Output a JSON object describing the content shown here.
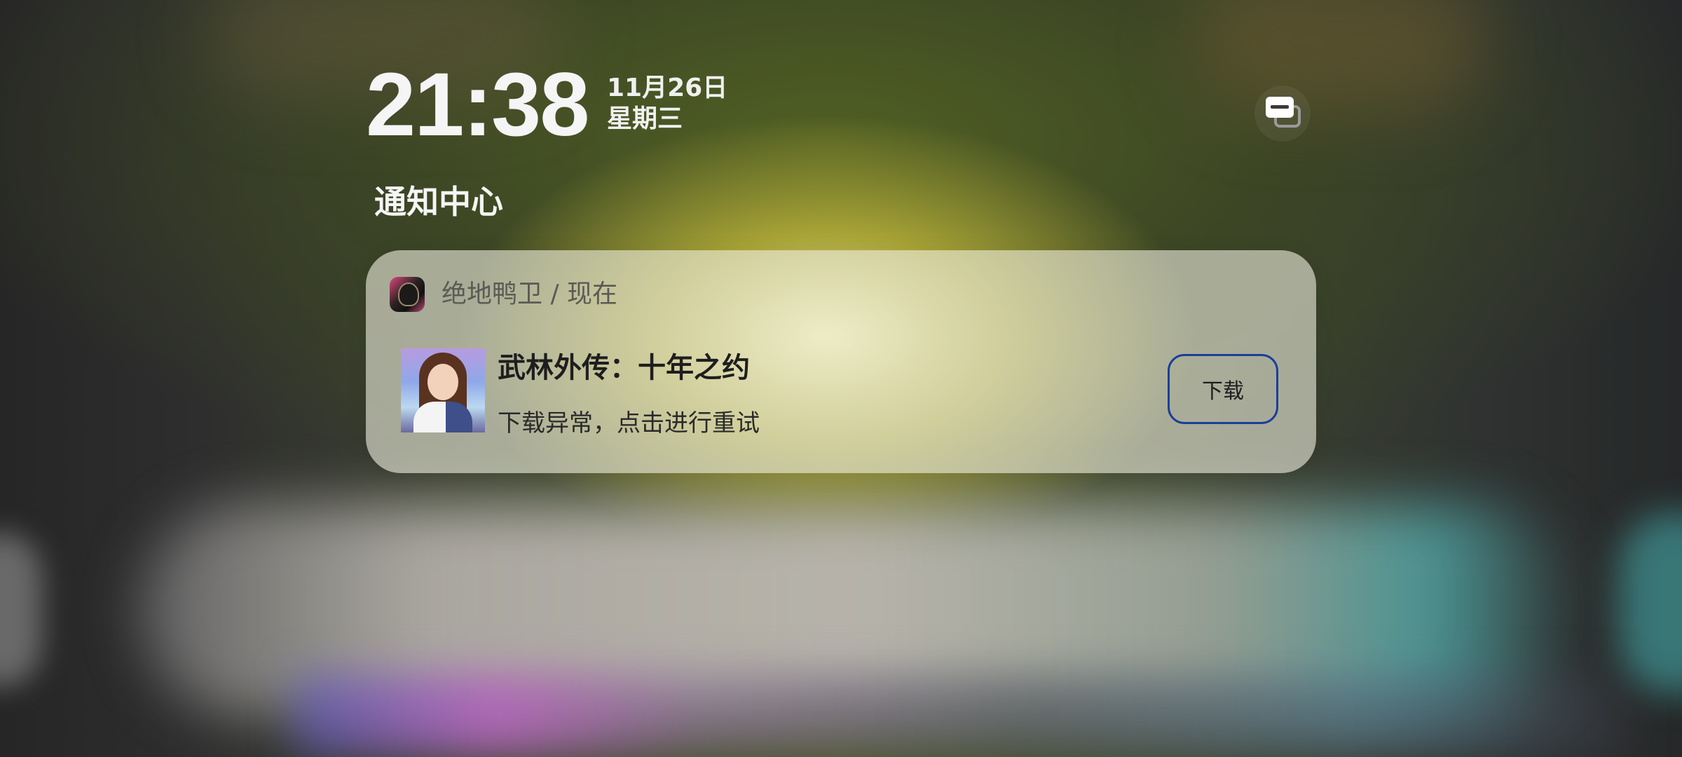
{
  "lockscreen": {
    "time": "21:38",
    "date": "11月26日",
    "weekday": "星期三"
  },
  "notification_center": {
    "title": "通知中心"
  },
  "notification": {
    "app_name_time": "绝地鸭卫 / 现在",
    "title": "武林外传：十年之约",
    "body": "下载异常，点击进行重试",
    "action_label": "下载",
    "action_border_color": "#1a3f9a"
  },
  "icons": {
    "switch": "notification-switch-icon",
    "app": "app-icon",
    "thumbnail": "game-thumbnail"
  }
}
